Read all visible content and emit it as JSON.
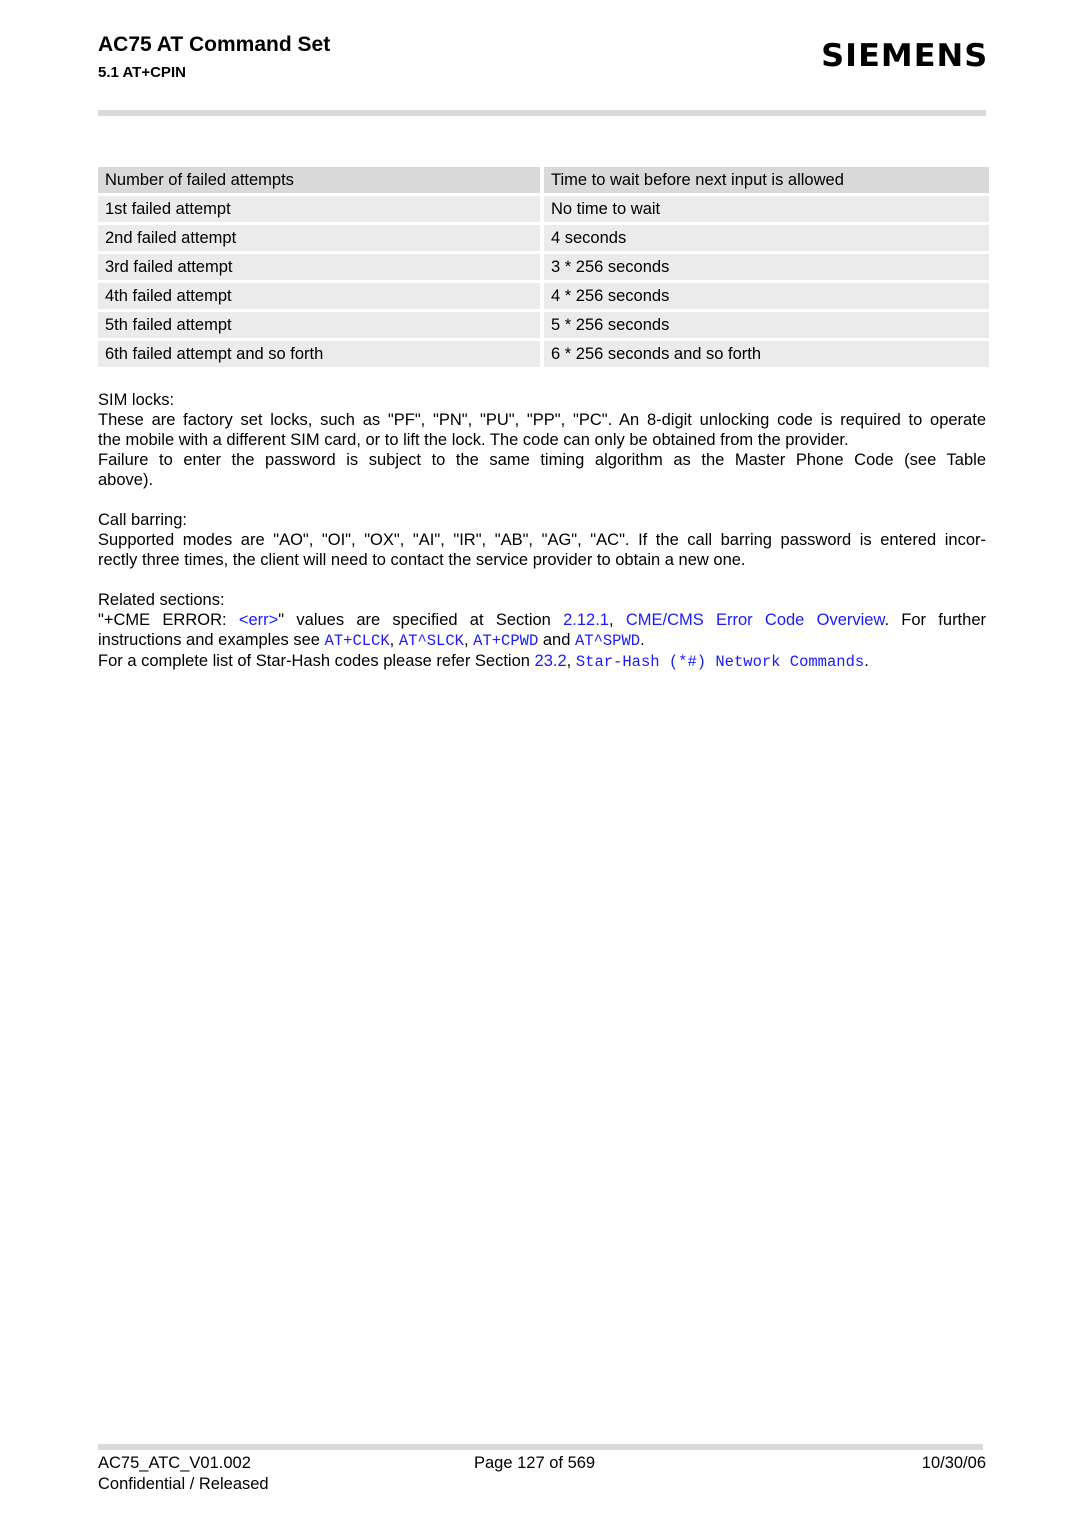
{
  "header": {
    "title": "AC75 AT Command Set",
    "subtitle": "5.1 AT+CPIN",
    "logo": "SIEMENS"
  },
  "table": {
    "headers": [
      "Number of failed attempts",
      "Time to wait before next input is allowed"
    ],
    "rows": [
      [
        "1st failed attempt",
        "No time to wait"
      ],
      [
        "2nd failed attempt",
        "4 seconds"
      ],
      [
        "3rd failed attempt",
        "3 * 256 seconds"
      ],
      [
        "4th failed attempt",
        "4 * 256 seconds"
      ],
      [
        "5th failed attempt",
        "5 * 256 seconds"
      ],
      [
        "6th failed attempt and so forth",
        "6 * 256 seconds and so forth"
      ]
    ]
  },
  "sim_locks": {
    "heading": "SIM locks:",
    "line1": "These are factory set locks, such as \"PF\", \"PN\", \"PU\", \"PP\", \"PC\". An 8-digit unlocking code is required to operate",
    "line2": "the mobile with a different SIM card, or to lift the lock. The code can only be obtained from the provider.",
    "line3": "Failure to enter the password is subject to the same timing algorithm as the Master Phone Code (see Table",
    "line4": "above)."
  },
  "call_barring": {
    "heading": "Call barring:",
    "line1": "Supported modes are \"AO\", \"OI\", \"OX\", \"AI\", \"IR\", \"AB\", \"AG\", \"AC\". If the call barring password is entered incor-",
    "line2": "rectly three times, the client will need to contact the service provider to obtain a new one."
  },
  "related": {
    "heading": "Related sections:",
    "l1_pre": "\"+CME ERROR: ",
    "l1_err_link": "<err>",
    "l1_mid": "\" values are specified at Section ",
    "l1_section_link": "2.12.1",
    "l1_comma": ", ",
    "l1_title_link": "CME/CMS Error Code Overview",
    "l1_post": ". For further",
    "l2_pre": "instructions and examples see ",
    "l2_link1": "AT+CLCK",
    "l2_sep1": ", ",
    "l2_link2": "AT^SLCK",
    "l2_sep2": ", ",
    "l2_link3": "AT+CPWD",
    "l2_and": " and ",
    "l2_link4": "AT^SPWD",
    "l2_end": ".",
    "l3_pre": "For a complete list of Star-Hash codes please refer Section ",
    "l3_section_link": "23.2",
    "l3_comma": ", ",
    "l3_title_link": "Star-Hash (*#) Network Commands",
    "l3_end": "."
  },
  "footer": {
    "doc_id": "AC75_ATC_V01.002",
    "classification": "Confidential / Released",
    "page": "Page 127 of 569",
    "date": "10/30/06"
  },
  "colors": {
    "link": "#1a1aff",
    "table_header_bg": "#d9d9d9",
    "table_cell_bg": "#ebebeb",
    "rule": "#d9d9d9"
  }
}
